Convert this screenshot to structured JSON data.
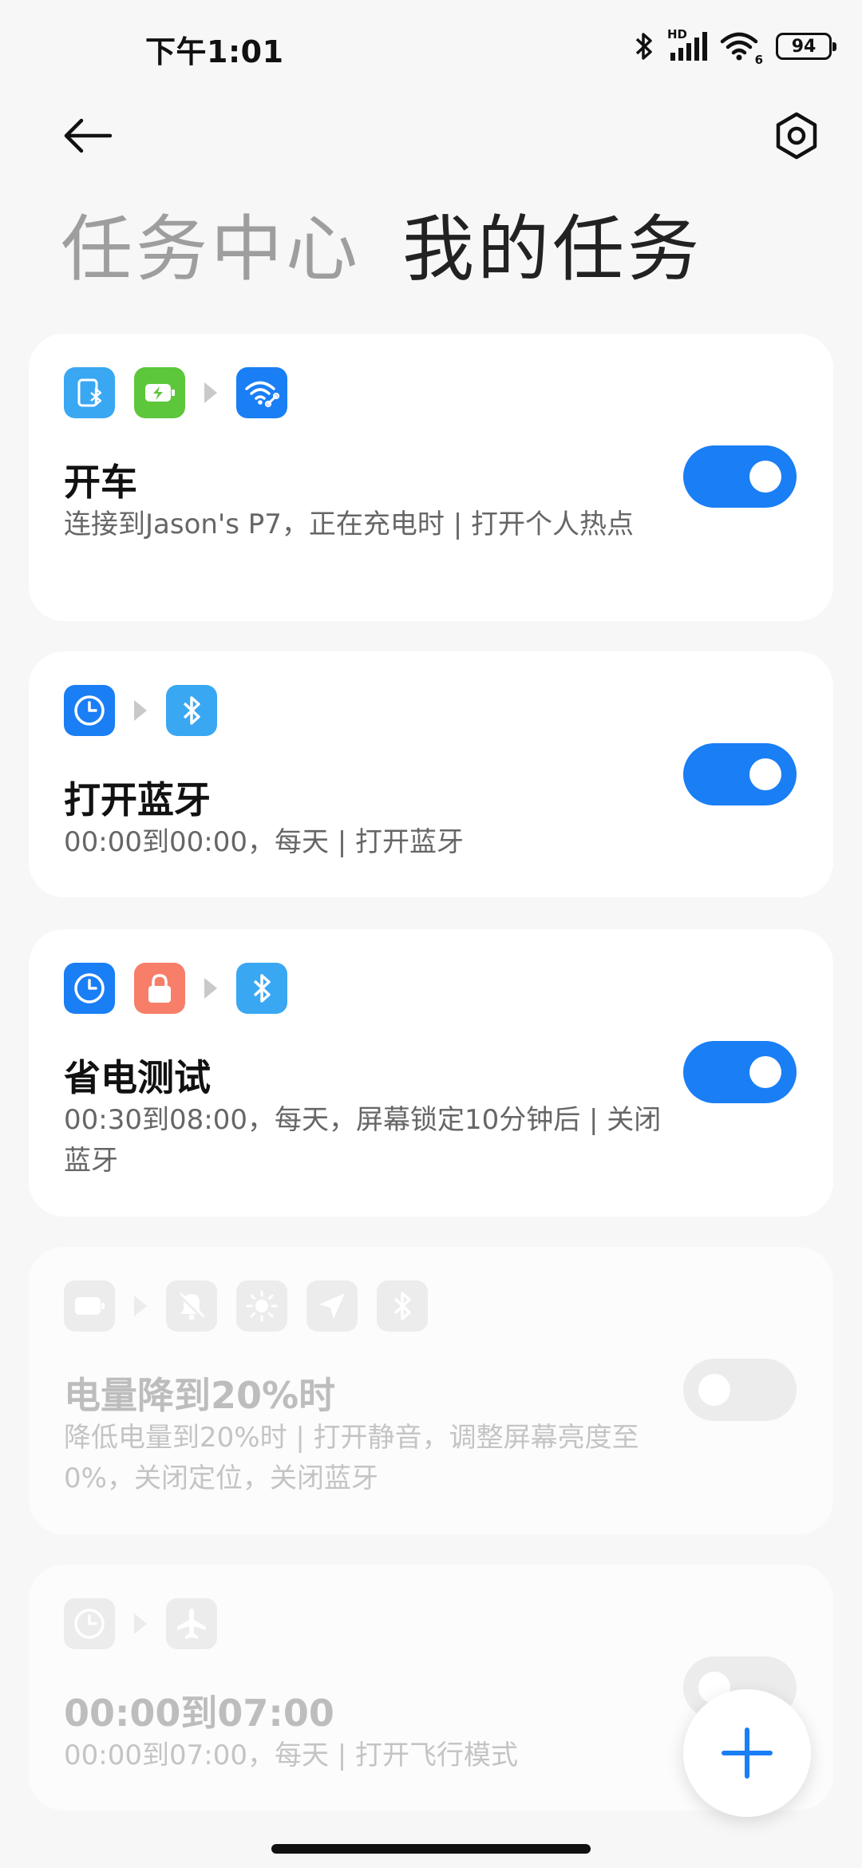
{
  "status_bar": {
    "time": "下午1:01",
    "network_label": "HD",
    "wifi_label": "6",
    "battery": "94"
  },
  "header": {
    "back_icon": "back-arrow-icon",
    "settings_icon": "gear-icon",
    "tab_task_center": "任务中心",
    "tab_my_tasks": "我的任务"
  },
  "colors": {
    "accent": "#1a7ef5",
    "tile_light_blue": "#3aa7f3",
    "tile_green": "#5dc73b",
    "tile_blue": "#1a7ef5",
    "tile_salmon": "#f77e68",
    "tile_disabled": "#ececec"
  },
  "tasks": [
    {
      "title": "开车",
      "desc": "连接到Jason's P7，正在充电时 | 打开个人热点",
      "enabled": true,
      "icons": [
        "bluetooth-device-icon",
        "battery-charging-icon",
        "wifi-hotspot-icon"
      ]
    },
    {
      "title": "打开蓝牙",
      "desc": "00:00到00:00，每天 | 打开蓝牙",
      "enabled": true,
      "icons": [
        "clock-icon",
        "bluetooth-icon"
      ]
    },
    {
      "title": "省电测试",
      "desc": "00:30到08:00，每天，屏幕锁定10分钟后 | 关闭蓝牙",
      "enabled": true,
      "icons": [
        "clock-icon",
        "lock-icon",
        "bluetooth-icon"
      ]
    },
    {
      "title": "电量降到20%时",
      "desc": "降低电量到20%时 | 打开静音，调整屏幕亮度至0%，关闭定位，关闭蓝牙",
      "enabled": false,
      "icons": [
        "battery-icon",
        "mute-icon",
        "brightness-icon",
        "location-icon",
        "bluetooth-icon"
      ]
    },
    {
      "title": "00:00到07:00",
      "desc": "00:00到07:00，每天 | 打开飞行模式",
      "enabled": false,
      "icons": [
        "clock-icon",
        "airplane-icon"
      ]
    }
  ],
  "fab": {
    "icon": "plus-icon"
  }
}
